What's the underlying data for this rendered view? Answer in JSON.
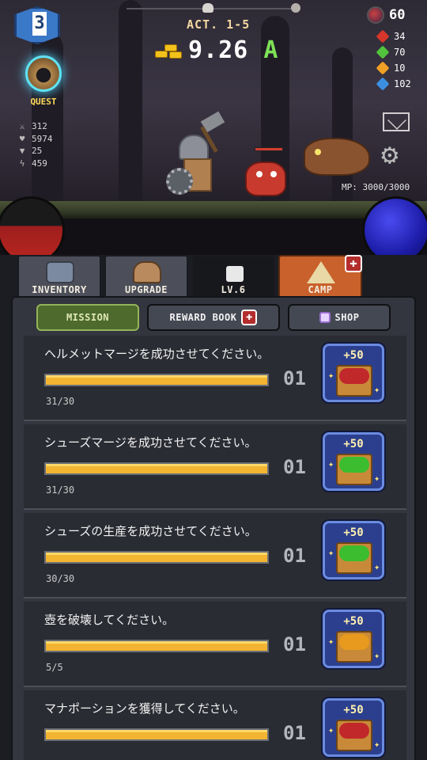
{
  "hud": {
    "player_level": "3",
    "quest_label": "QUEST",
    "act": "ACT. 1-5",
    "gold_amount": "9.26",
    "gold_unit": "A",
    "premium_currency": "60",
    "stats": [
      "312",
      "5974",
      "25",
      "459"
    ],
    "resources": [
      {
        "value": "34",
        "color": "#d6362b"
      },
      {
        "value": "70",
        "color": "#53c23d"
      },
      {
        "value": "10",
        "color": "#f0a024"
      },
      {
        "value": "102",
        "color": "#3c8fe0"
      }
    ],
    "mp_readout": "MP: 3000/3000",
    "hp_fraction": 0.58,
    "mp_fraction": 1.0
  },
  "tabs": [
    {
      "label": "INVENTORY"
    },
    {
      "label": "UPGRADE"
    },
    {
      "label": "LV.6"
    },
    {
      "label": "CAMP"
    }
  ],
  "subtabs": {
    "mission": "MISSION",
    "reward_book": "REWARD BOOK",
    "shop": "SHOP"
  },
  "missions": [
    {
      "title": "ヘルメットマージを成功させてください。",
      "count": "01",
      "progress": "31/30",
      "reward": "+50",
      "gem_color": "#c0282a",
      "fill": 1.0
    },
    {
      "title": "シューズマージを成功させてください。",
      "count": "01",
      "progress": "31/30",
      "reward": "+50",
      "gem_color": "#3bbd2f",
      "fill": 1.0
    },
    {
      "title": "シューズの生産を成功させてください。",
      "count": "01",
      "progress": "30/30",
      "reward": "+50",
      "gem_color": "#3bbd2f",
      "fill": 1.0
    },
    {
      "title": "壺を破壊してください。",
      "count": "01",
      "progress": "5/5",
      "reward": "+50",
      "gem_color": "#e79a1d",
      "fill": 1.0
    },
    {
      "title": "マナポーションを獲得してください。",
      "count": "01",
      "progress": "",
      "reward": "+50",
      "gem_color": "#c0282a",
      "fill": 1.0
    }
  ]
}
